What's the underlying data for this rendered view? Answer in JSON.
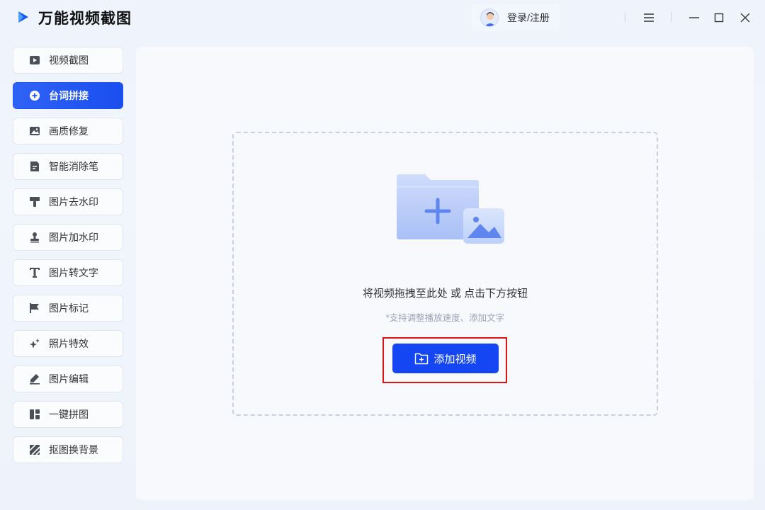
{
  "app": {
    "title": "万能视频截图",
    "logo_icon": "play-arrow-logo"
  },
  "header": {
    "login_label": "登录/注册",
    "avatar_icon": "user-avatar-icon",
    "controls": [
      "menu-icon",
      "minimize-icon",
      "maximize-icon",
      "close-icon"
    ]
  },
  "sidebar": {
    "items": [
      {
        "label": "视频截图",
        "icon": "video-icon",
        "active": false
      },
      {
        "label": "台词拼接",
        "icon": "plus-circle-icon",
        "active": true
      },
      {
        "label": "画质修复",
        "icon": "image-icon",
        "active": false
      },
      {
        "label": "智能消除笔",
        "icon": "document-icon",
        "active": false
      },
      {
        "label": "图片去水印",
        "icon": "brush-icon",
        "active": false
      },
      {
        "label": "图片加水印",
        "icon": "stamp-icon",
        "active": false
      },
      {
        "label": "图片转文字",
        "icon": "text-icon",
        "active": false
      },
      {
        "label": "图片标记",
        "icon": "flag-icon",
        "active": false
      },
      {
        "label": "照片特效",
        "icon": "sparkle-icon",
        "active": false
      },
      {
        "label": "图片编辑",
        "icon": "edit-icon",
        "active": false
      },
      {
        "label": "一键拼图",
        "icon": "collage-icon",
        "active": false
      },
      {
        "label": "抠图换背景",
        "icon": "stripes-icon",
        "active": false
      }
    ]
  },
  "main": {
    "drop_hint": "将视频拖拽至此处 或 点击下方按钮",
    "drop_sub": "*支持调整播放速度、添加文字",
    "add_button_label": "添加视频"
  },
  "colors": {
    "accent": "#1446f3",
    "highlight": "#e01313"
  }
}
